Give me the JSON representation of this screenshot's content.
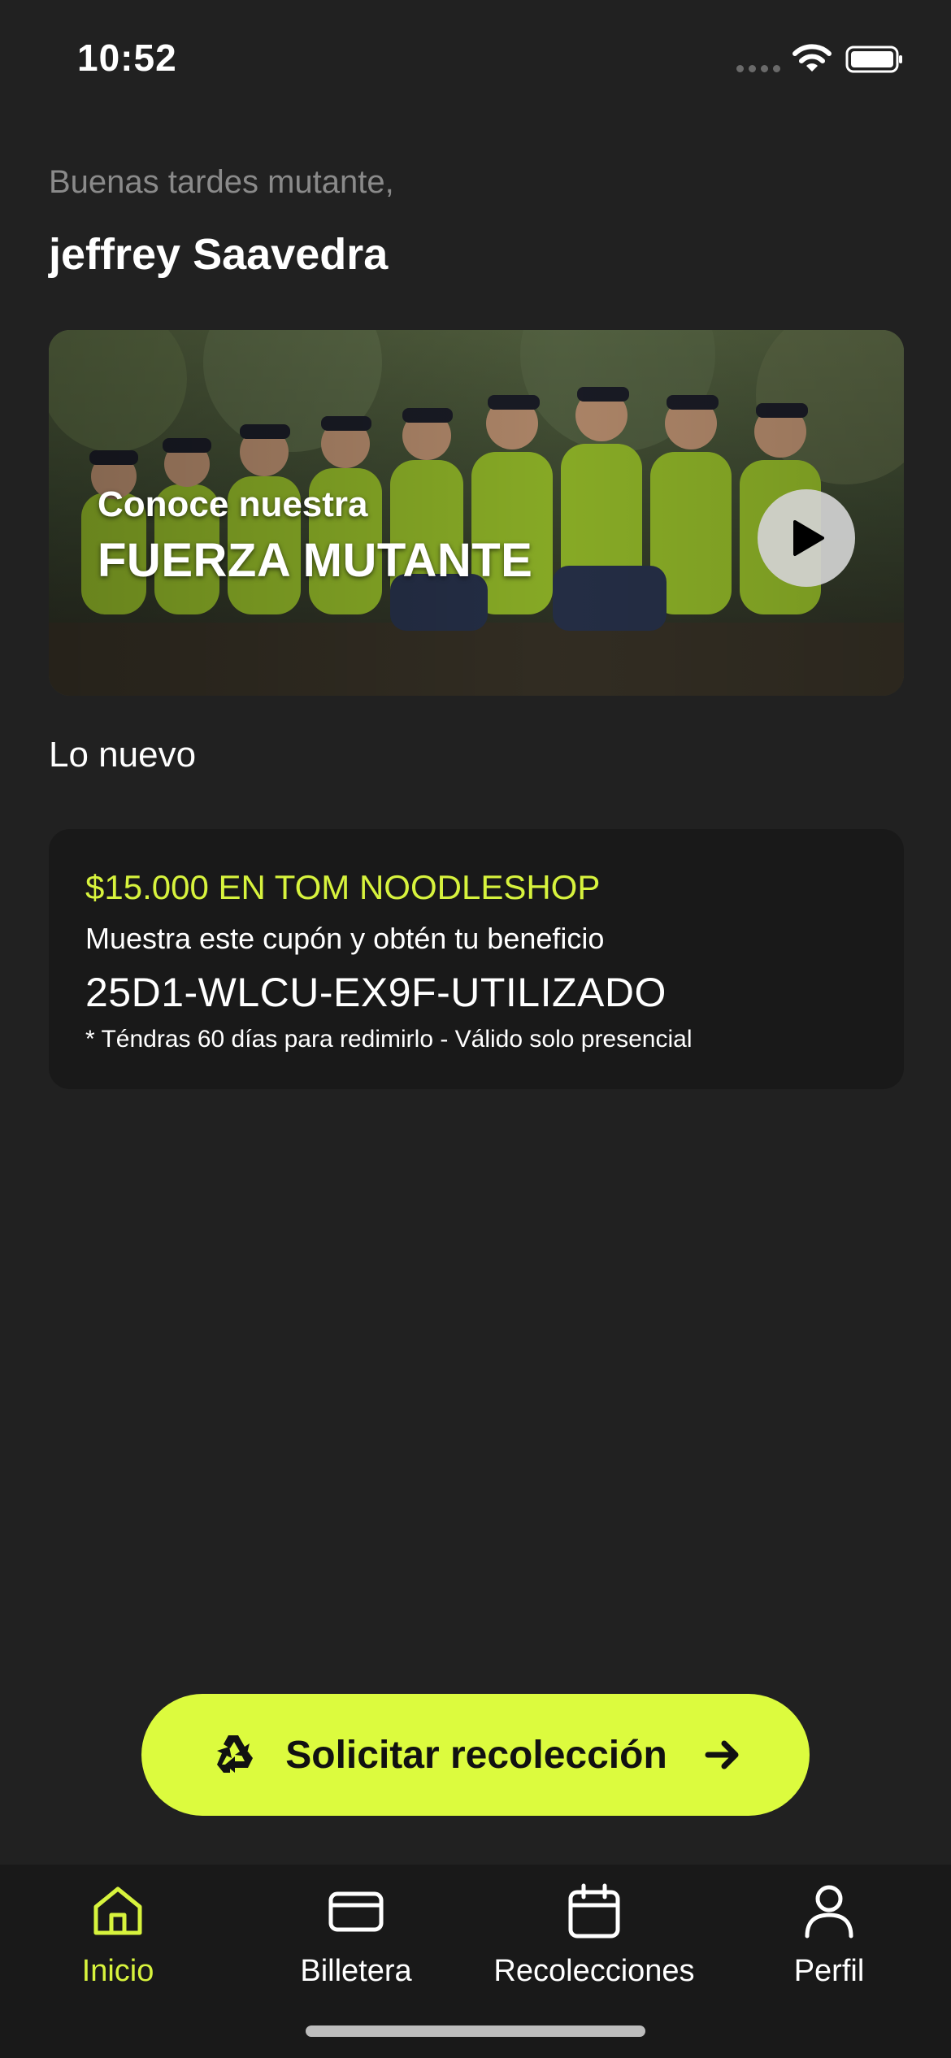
{
  "status_bar": {
    "time": "10:52"
  },
  "greeting": {
    "salutation": "Buenas tardes mutante,",
    "user_name": "jeffrey Saavedra"
  },
  "banner": {
    "subtitle": "Conoce nuestra",
    "title": "FUERZA MUTANTE",
    "play_icon": "play-icon"
  },
  "section": {
    "heading": "Lo nuevo"
  },
  "coupon": {
    "title": "$15.000 EN TOM NOODLESHOP",
    "description": "Muestra este cupón y obtén tu beneficio",
    "code": "25D1-WLCU-EX9F-UTILIZADO",
    "note": "* Téndras 60 días para redimirlo - Válido solo presencial"
  },
  "cta": {
    "label": "Solicitar recolección",
    "icon": "recycle-icon",
    "arrow_icon": "arrow-right-icon"
  },
  "bottom_nav": {
    "items": [
      {
        "label": "Inicio",
        "icon": "home-icon",
        "active": true
      },
      {
        "label": "Billetera",
        "icon": "card-icon",
        "active": false
      },
      {
        "label": "Recolecciones",
        "icon": "calendar-icon",
        "active": false
      },
      {
        "label": "Perfil",
        "icon": "user-icon",
        "active": false
      }
    ]
  },
  "colors": {
    "background": "#212121",
    "card": "#191919",
    "accent": "#dcfb3e",
    "accent_text": "#d7f33d",
    "muted_text": "#8a8a8a"
  }
}
